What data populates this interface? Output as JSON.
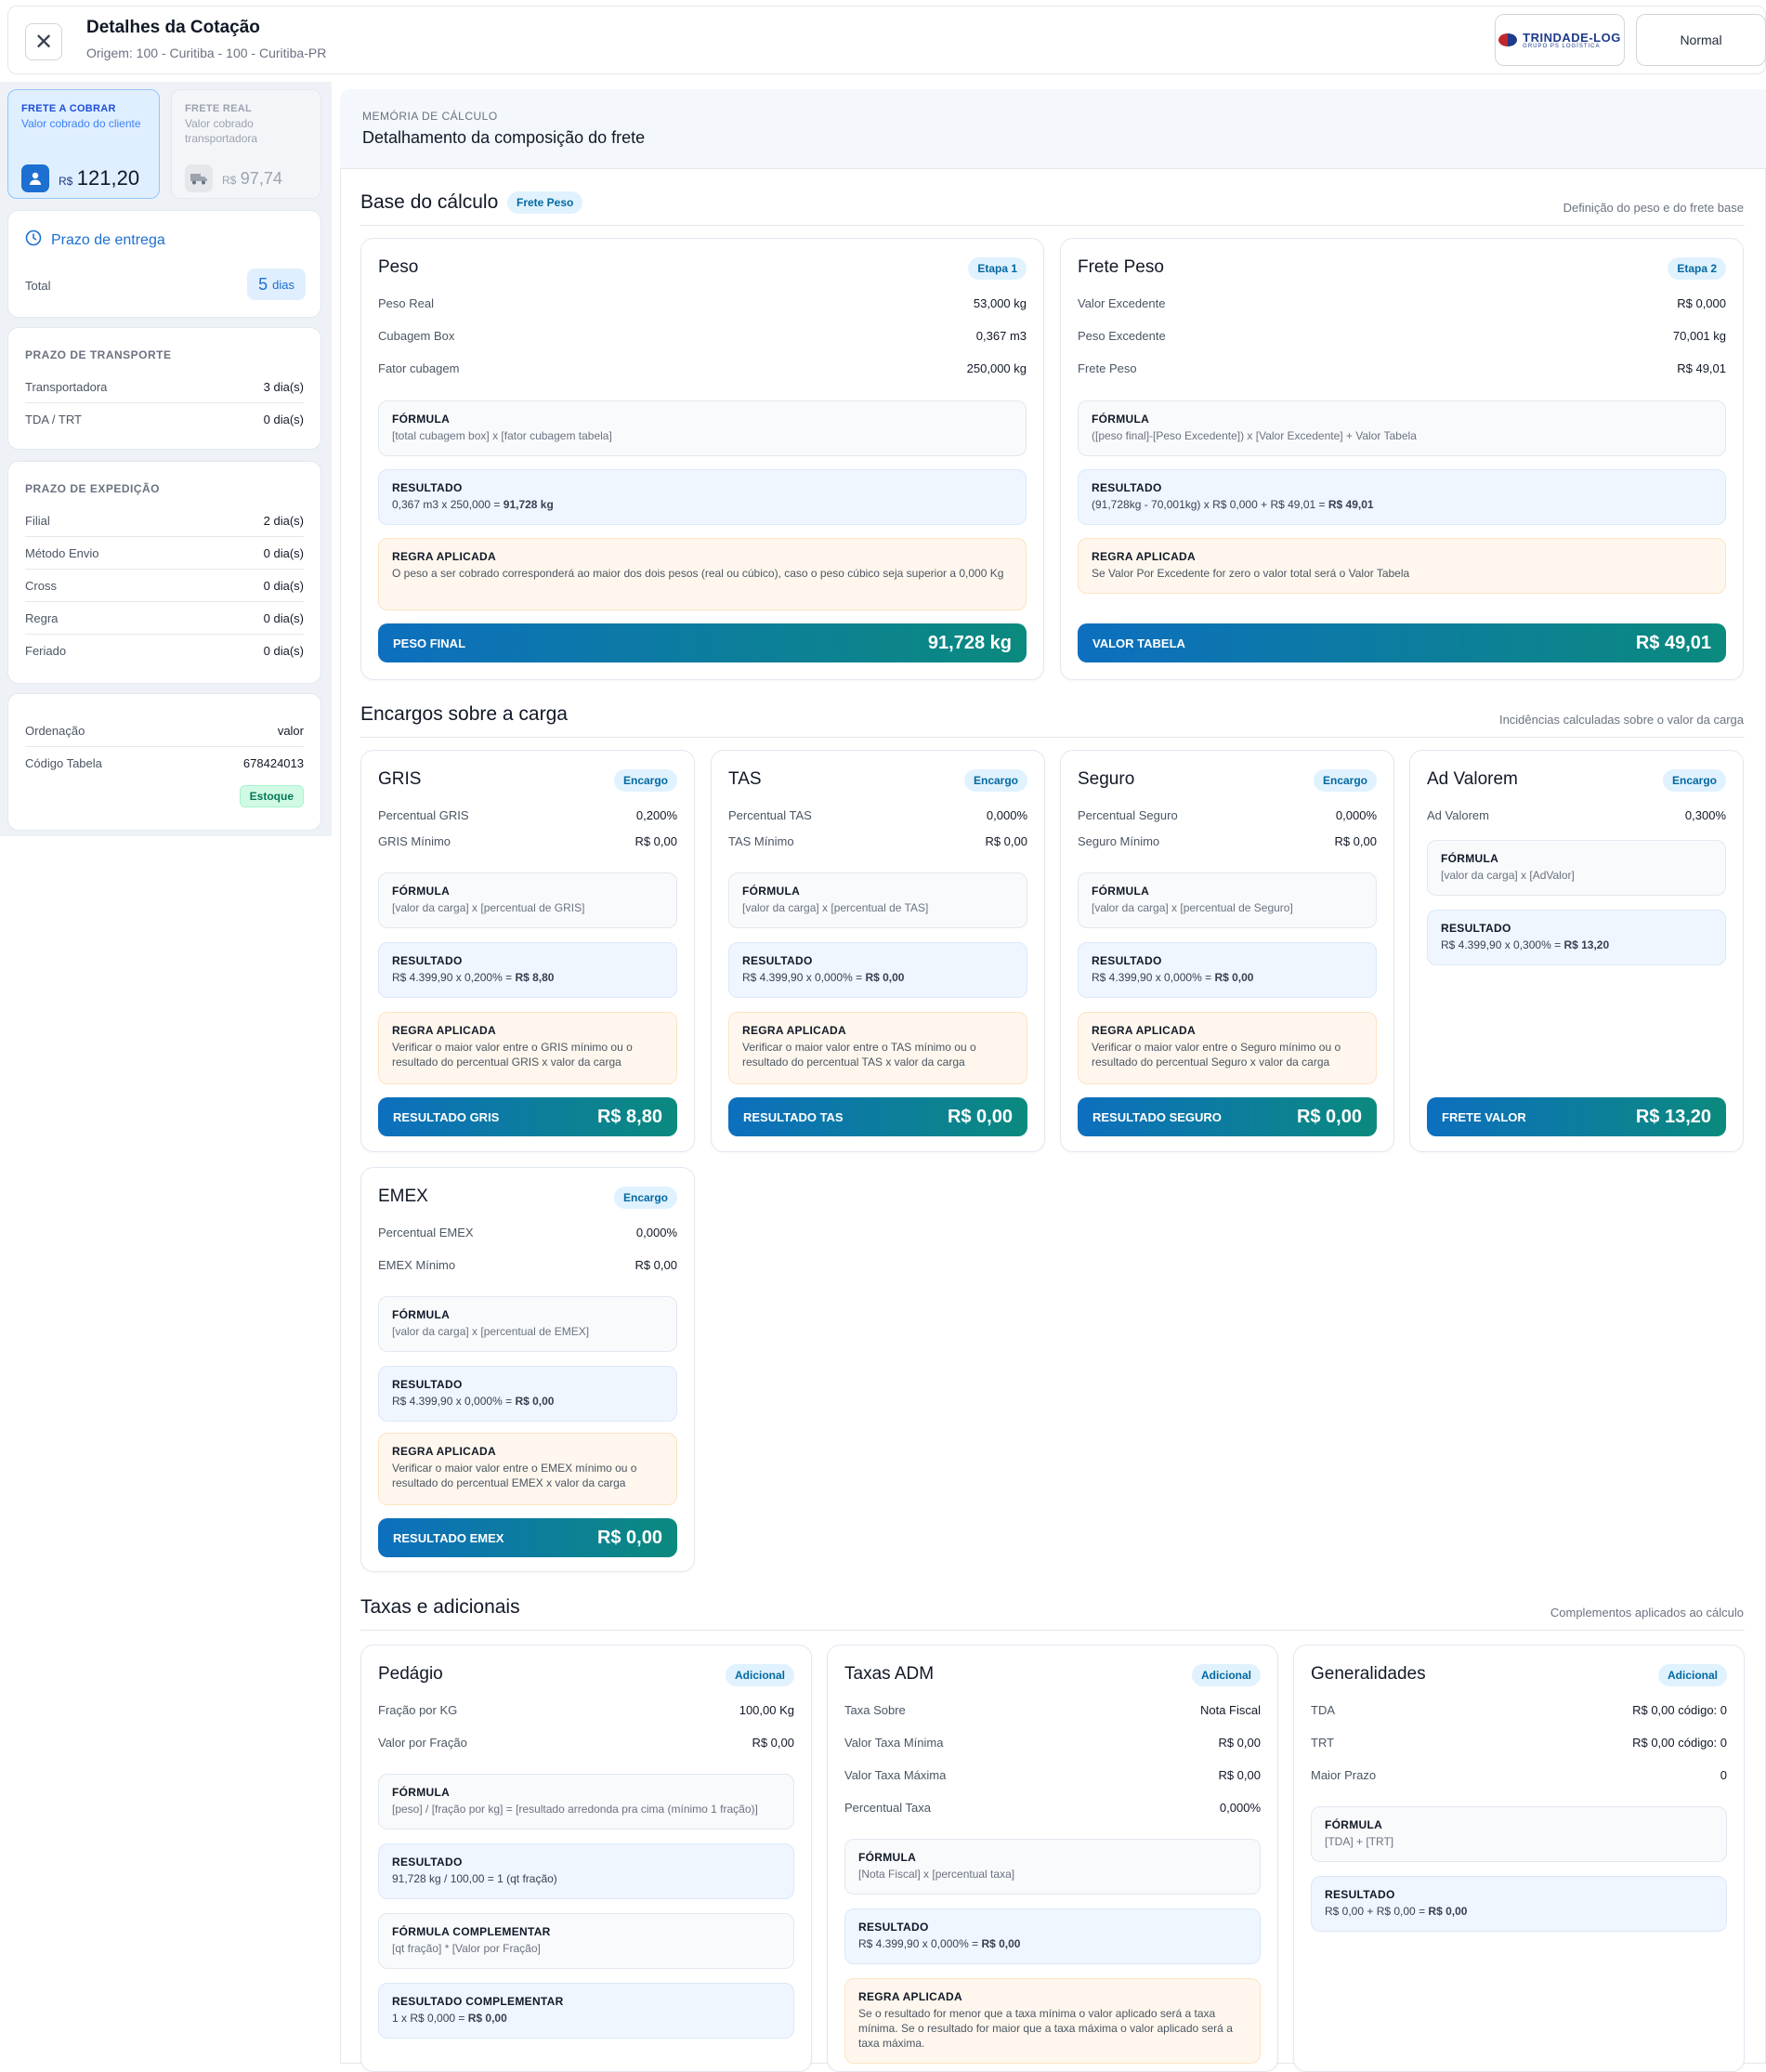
{
  "header": {
    "title": "Detalhes da Cotação",
    "subtitle": "Origem: 100 - Curitiba - 100 - Curitiba-PR",
    "logo_text": "TRINDADE-LOG",
    "logo_sub": "GRUPO PS LOGÍSTICA",
    "mode_button": "Normal"
  },
  "colors": {
    "accent": "#0d6fbf",
    "accent_end": "#0b8a7e",
    "badge_bg": "#e0f2fe",
    "rule_bg": "#fff7ed",
    "result_bg": "#eff6ff"
  },
  "sidebar": {
    "frete_cobrar": {
      "label": "FRETE A COBRAR",
      "sub": "Valor cobrado do cliente",
      "currency": "R$",
      "value": "121,20",
      "icon": "user-icon"
    },
    "frete_real": {
      "label": "FRETE REAL",
      "sub": "Valor cobrado transportadora",
      "currency": "R$",
      "value": "97,74",
      "icon": "truck-icon"
    },
    "prazo": {
      "title": "Prazo de entrega",
      "total_label": "Total",
      "total_value": "5",
      "total_unit": "dias",
      "icon": "clock-icon"
    },
    "transporte": {
      "title": "PRAZO DE TRANSPORTE",
      "rows": [
        {
          "k": "Transportadora",
          "v": "3 dia(s)"
        },
        {
          "k": "TDA / TRT",
          "v": "0 dia(s)"
        }
      ]
    },
    "expedicao": {
      "title": "PRAZO DE EXPEDIÇÃO",
      "rows": [
        {
          "k": "Filial",
          "v": "2 dia(s)"
        },
        {
          "k": "Método Envio",
          "v": "0 dia(s)"
        },
        {
          "k": "Cross",
          "v": "0 dia(s)"
        },
        {
          "k": "Regra",
          "v": "0 dia(s)"
        },
        {
          "k": "Feriado",
          "v": "0 dia(s)"
        }
      ]
    },
    "info": {
      "rows": [
        {
          "k": "Ordenação",
          "v": "valor"
        },
        {
          "k": "Código Tabela",
          "v": "678424013"
        }
      ],
      "tag": "Estoque"
    }
  },
  "main": {
    "kicker": "MEMÓRIA DE CÁLCULO",
    "title": "Detalhamento da composição do frete",
    "base": {
      "title": "Base do cálculo",
      "badge": "Frete Peso",
      "right": "Definição do peso e do frete base",
      "peso": {
        "title": "Peso",
        "badge": "Etapa 1",
        "rows": [
          {
            "k": "Peso Real",
            "v": "53,000 kg"
          },
          {
            "k": "Cubagem Box",
            "v": "0,367 m3"
          },
          {
            "k": "Fator cubagem",
            "v": "250,000 kg"
          }
        ],
        "formula_label": "FÓRMULA",
        "formula": "[total cubagem box] x [fator cubagem tabela]",
        "result_label": "RESULTADO",
        "result": "0,367 m3 x 250,000 =",
        "result_strong": "91,728 kg",
        "rule_label": "REGRA APLICADA",
        "rule": "O peso a ser cobrado corresponderá ao maior dos dois pesos (real ou cúbico), caso o peso cúbico seja superior a 0,000 Kg",
        "bar_label": "PESO FINAL",
        "bar_value": "91,728 kg"
      },
      "frete": {
        "title": "Frete Peso",
        "badge": "Etapa 2",
        "rows": [
          {
            "k": "Valor Excedente",
            "v": "R$ 0,000"
          },
          {
            "k": "Peso Excedente",
            "v": "70,001 kg"
          },
          {
            "k": "Frete Peso",
            "v": "R$ 49,01"
          }
        ],
        "formula_label": "FÓRMULA",
        "formula": "([peso final]-[Peso Excedente]) x [Valor Excedente] + Valor Tabela",
        "result_label": "RESULTADO",
        "result": "(91,728kg - 70,001kg) x R$ 0,000 + R$ 49,01 =",
        "result_strong": "R$ 49,01",
        "rule_label": "REGRA APLICADA",
        "rule": "Se Valor Por Excedente for zero o valor total será o Valor Tabela",
        "bar_label": "VALOR TABELA",
        "bar_value": "R$ 49,01"
      }
    },
    "encargos": {
      "title": "Encargos sobre a carga",
      "right": "Incidências calculadas sobre o valor da carga",
      "cards": [
        {
          "title": "GRIS",
          "badge": "Encargo",
          "rows": [
            {
              "k": "Percentual GRIS",
              "v": "0,200%"
            },
            {
              "k": "GRIS Mínimo",
              "v": "R$ 0,00"
            }
          ],
          "formula": "[valor da carga] x [percentual de GRIS]",
          "result": "R$ 4.399,90 x 0,200% =",
          "result_strong": "R$ 8,80",
          "rule": "Verificar o maior valor entre o GRIS mínimo ou o resultado do percentual GRIS x valor da carga",
          "bar_label": "RESULTADO GRIS",
          "bar_value": "R$ 8,80"
        },
        {
          "title": "TAS",
          "badge": "Encargo",
          "rows": [
            {
              "k": "Percentual TAS",
              "v": "0,000%"
            },
            {
              "k": "TAS Mínimo",
              "v": "R$ 0,00"
            }
          ],
          "formula": "[valor da carga] x [percentual de TAS]",
          "result": "R$ 4.399,90 x 0,000% =",
          "result_strong": "R$ 0,00",
          "rule": "Verificar o maior valor entre o TAS mínimo ou o resultado do percentual TAS x valor da carga",
          "bar_label": "RESULTADO TAS",
          "bar_value": "R$ 0,00"
        },
        {
          "title": "Seguro",
          "badge": "Encargo",
          "rows": [
            {
              "k": "Percentual Seguro",
              "v": "0,000%"
            },
            {
              "k": "Seguro Mínimo",
              "v": "R$ 0,00"
            }
          ],
          "formula": "[valor da carga] x [percentual de Seguro]",
          "result": "R$ 4.399,90 x 0,000% =",
          "result_strong": "R$ 0,00",
          "rule": "Verificar o maior valor entre o Seguro mínimo ou o resultado do percentual Seguro x valor da carga",
          "bar_label": "RESULTADO SEGURO",
          "bar_value": "R$ 0,00"
        },
        {
          "title": "Ad Valorem",
          "badge": "Encargo",
          "rows": [
            {
              "k": "Ad Valorem",
              "v": "0,300%"
            }
          ],
          "formula": "[valor da carga] x [AdValor]",
          "result": "R$ 4.399,90 x 0,300% =",
          "result_strong": "R$ 13,20",
          "bar_label": "FRETE VALOR",
          "bar_value": "R$ 13,20"
        },
        {
          "title": "EMEX",
          "badge": "Encargo",
          "rows": [
            {
              "k": "Percentual EMEX",
              "v": "0,000%"
            },
            {
              "k": "EMEX Mínimo",
              "v": "R$ 0,00"
            }
          ],
          "formula": "[valor da carga] x [percentual de EMEX]",
          "result": "R$ 4.399,90 x 0,000% =",
          "result_strong": "R$ 0,00",
          "rule": "Verificar o maior valor entre o EMEX mínimo ou o resultado do percentual EMEX x valor da carga",
          "bar_label": "RESULTADO EMEX",
          "bar_value": "R$ 0,00"
        }
      ]
    },
    "taxas": {
      "title": "Taxas e adicionais",
      "right": "Complementos aplicados ao cálculo",
      "pedagio": {
        "title": "Pedágio",
        "badge": "Adicional",
        "rows": [
          {
            "k": "Fração por KG",
            "v": "100,00 Kg"
          },
          {
            "k": "Valor por Fração",
            "v": "R$ 0,00"
          }
        ],
        "formula_label": "FÓRMULA",
        "formula": "[peso] / [fração por kg] = [resultado arredonda pra cima (mínimo 1 fração)]",
        "result_label": "RESULTADO",
        "result": "91,728 kg / 100,00 = 1 (qt fração)",
        "formula2_label": "FÓRMULA COMPLEMENTAR",
        "formula2": "[qt fração] * [Valor por Fração]",
        "result2_label": "RESULTADO COMPLEMENTAR",
        "result2": "1 x R$ 0,000 =",
        "result2_strong": "R$ 0,00"
      },
      "adm": {
        "title": "Taxas ADM",
        "badge": "Adicional",
        "rows": [
          {
            "k": "Taxa Sobre",
            "v": "Nota Fiscal"
          },
          {
            "k": "Valor Taxa Mínima",
            "v": "R$ 0,00"
          },
          {
            "k": "Valor Taxa Máxima",
            "v": "R$ 0,00"
          },
          {
            "k": "Percentual Taxa",
            "v": "0,000%"
          }
        ],
        "formula_label": "FÓRMULA",
        "formula": "[Nota Fiscal] x [percentual taxa]",
        "result_label": "RESULTADO",
        "result": "R$ 4.399,90 x 0,000% =",
        "result_strong": "R$ 0,00",
        "rule_label": "REGRA APLICADA",
        "rule": "Se o resultado for menor que a taxa mínima o valor aplicado será a taxa mínima. Se o resultado for maior que a taxa máxima o valor aplicado será a taxa máxima."
      },
      "gen": {
        "title": "Generalidades",
        "badge": "Adicional",
        "rows": [
          {
            "k": "TDA",
            "v": "R$ 0,00 código: 0"
          },
          {
            "k": "TRT",
            "v": "R$ 0,00 código: 0"
          },
          {
            "k": "Maior Prazo",
            "v": "0"
          }
        ],
        "formula_label": "FÓRMULA",
        "formula": "[TDA] + [TRT]",
        "result_label": "RESULTADO",
        "result": "R$ 0,00 + R$ 0,00 =",
        "result_strong": "R$ 0,00"
      }
    },
    "labels": {
      "formula": "FÓRMULA",
      "result": "RESULTADO",
      "rule": "REGRA APLICADA"
    }
  }
}
